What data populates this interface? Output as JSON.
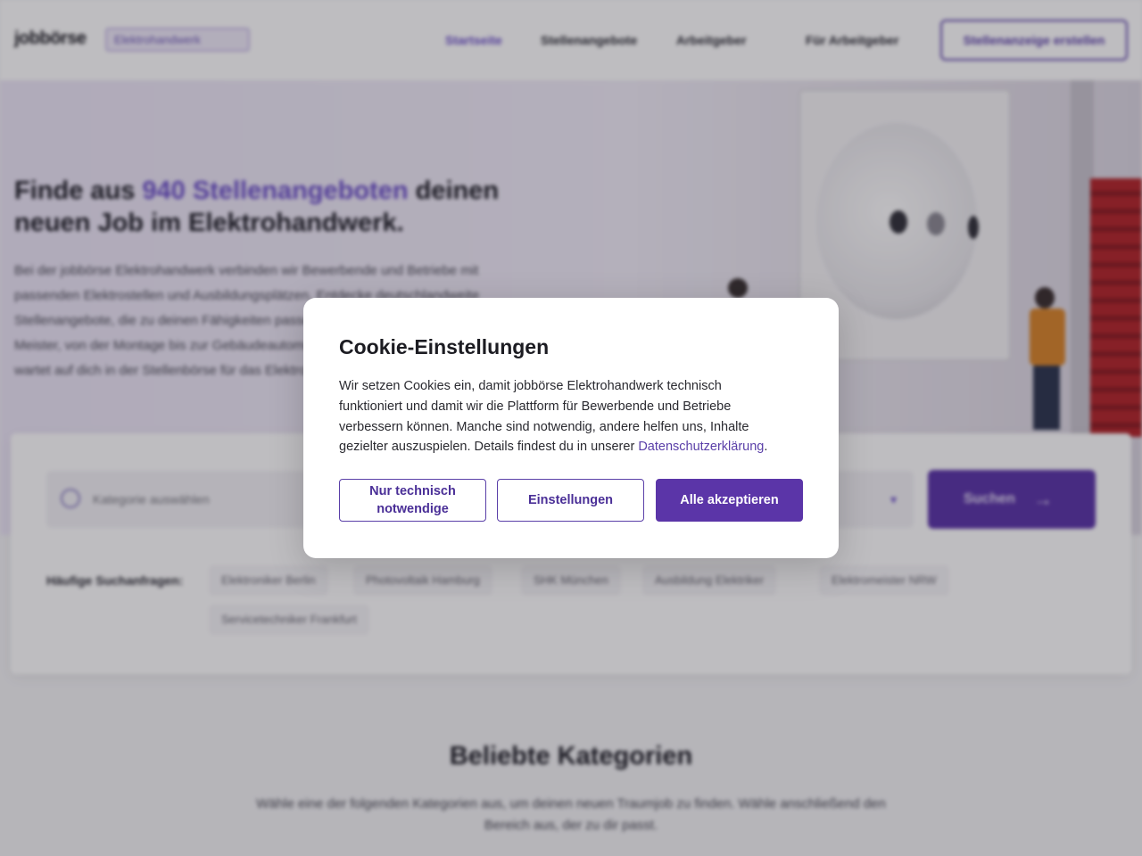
{
  "header": {
    "logo": "jobbörse",
    "logo_chip": "Elektrohandwerk",
    "nav": [
      "Startseite",
      "Stellenangebote",
      "Arbeitgeber",
      "Für Arbeitgeber"
    ],
    "cta": "Stellenanzeige erstellen"
  },
  "hero": {
    "title_before": "Finde aus ",
    "title_highlight": "940 Stellenangeboten",
    "title_after": " deinen neuen Job im Elektrohandwerk.",
    "description": "Bei der jobbörse Elektrohandwerk verbinden wir Bewerbende und Betriebe mit passenden Elektrostellen und Ausbildungsplätzen. Entdecke deutschlandweite Stellenangebote, die zu deinen Fähigkeiten passen – vom Azubi bis zum Meister, von der Montage bis zur Gebäudeautomation. Deine Traumstelle wartet auf dich in der Stellenbörse für das Elektrohandwerk."
  },
  "search": {
    "placeholder": "Kategorie auswählen",
    "button": "Suchen",
    "frequent_label": "Häufige Suchanfragen:",
    "chips": [
      "Elektroniker Berlin",
      "Photovoltaik Hamburg",
      "SHK München",
      "Ausbildung Elektriker",
      "Elektromeister NRW",
      "Servicetechniker Frankfurt"
    ]
  },
  "categories": {
    "title": "Beliebte Kategorien",
    "subtitle": "Wähle eine der folgenden Kategorien aus, um deinen neuen Traumjob zu finden. Wähle anschließend den Bereich aus, der zu dir passt."
  },
  "cookie_modal": {
    "title": "Cookie-Einstellungen",
    "text": "Wir setzen Cookies ein, damit jobbörse Elektrohandwerk technisch funktioniert und damit wir die Plattform für Bewerbende und Betriebe verbessern können. Manche sind notwendig, andere helfen uns, Inhalte gezielter auszuspielen. Details findest du in unserer ",
    "link": "Datenschutzerklärung",
    "text_end": ".",
    "btn_necessary": "Nur technisch notwendige",
    "btn_settings": "Einstellungen",
    "btn_accept": "Alle akzeptieren"
  },
  "colors": {
    "accent": "#5b35a8",
    "highlight": "#6b4fc9"
  }
}
